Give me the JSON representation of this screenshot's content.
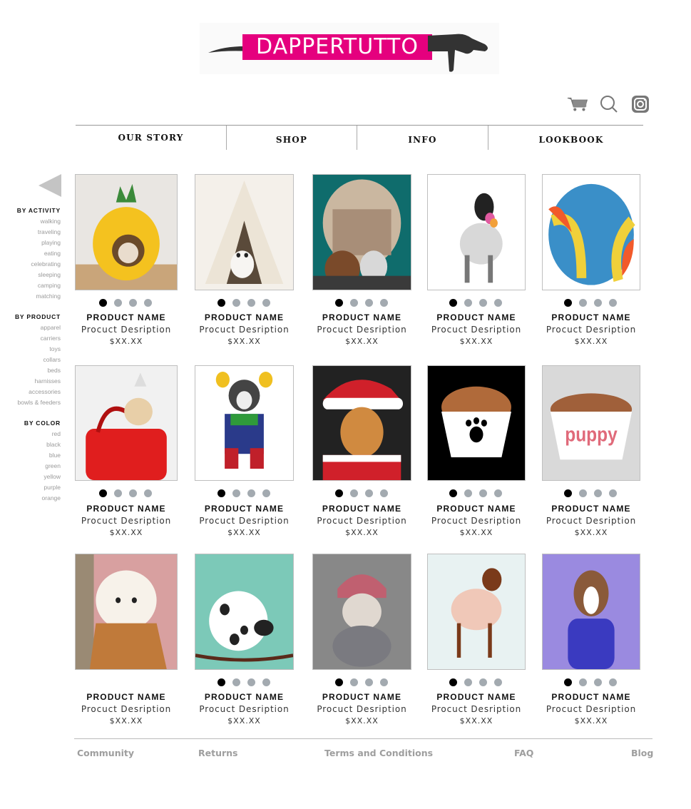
{
  "brand": {
    "logo_text": "DAPPERTUTTO",
    "logo_color": "#e5007e"
  },
  "header_icons": [
    "cart-icon",
    "search-icon",
    "instagram-icon"
  ],
  "nav": [
    {
      "label": "OUR STORY"
    },
    {
      "label": "SHOP"
    },
    {
      "label": "INFO"
    },
    {
      "label": "LOOKBOOK"
    }
  ],
  "sidebar": {
    "activity": {
      "heading": "BY ACTIVITY",
      "items": [
        "walking",
        "traveling",
        "playing",
        "eating",
        "celebrating",
        "sleeping",
        "camping",
        "matching"
      ]
    },
    "product": {
      "heading": "BY PRODUCT",
      "items": [
        "apparel",
        "carriers",
        "toys",
        "collars",
        "beds",
        "harnisses",
        "accessories",
        "bowls & feeders"
      ]
    },
    "color": {
      "heading": "BY COLOR",
      "items": [
        "red",
        "black",
        "blue",
        "green",
        "yellow",
        "purple",
        "orange"
      ]
    }
  },
  "products": [
    {
      "image": "pineapple-dog-bed",
      "name": "PRODUCT NAME",
      "desc": "Procuct Desription",
      "price": "$XX.XX",
      "dots": 4
    },
    {
      "image": "teepee-dog-tent",
      "name": "PRODUCT NAME",
      "desc": "Procuct Desription",
      "price": "$XX.XX",
      "dots": 4
    },
    {
      "image": "dogs-in-camping-tent",
      "name": "PRODUCT NAME",
      "desc": "Procuct Desription",
      "price": "$XX.XX",
      "dots": 4
    },
    {
      "image": "spaniel-with-rope-toy",
      "name": "PRODUCT NAME",
      "desc": "Procuct Desription",
      "price": "$XX.XX",
      "dots": 4
    },
    {
      "image": "tennis-ball-toy",
      "name": "PRODUCT NAME",
      "desc": "Procuct Desription",
      "price": "$XX.XX",
      "dots": 4
    },
    {
      "image": "chihuahua-in-red-bag",
      "name": "PRODUCT NAME",
      "desc": "Procuct Desription",
      "price": "$XX.XX",
      "dots": 4
    },
    {
      "image": "husky-costume",
      "name": "PRODUCT NAME",
      "desc": "Procuct Desription",
      "price": "$XX.XX",
      "dots": 4
    },
    {
      "image": "santa-dog-costume",
      "name": "PRODUCT NAME",
      "desc": "Procuct Desription",
      "price": "$XX.XX",
      "dots": 4
    },
    {
      "image": "paw-print-bowl",
      "name": "PRODUCT NAME",
      "desc": "Procuct Desription",
      "price": "$XX.XX",
      "dots": 4
    },
    {
      "image": "puppy-food-bowl",
      "name": "PRODUCT NAME",
      "desc": "Procuct Desription",
      "price": "$XX.XX",
      "dots": 4
    },
    {
      "image": "pomeranian-in-tote",
      "name": "PRODUCT NAME",
      "desc": "Procuct Desription",
      "price": "$XX.XX",
      "dots": 0
    },
    {
      "image": "dalmatian-leash",
      "name": "PRODUCT NAME",
      "desc": "Procuct Desription",
      "price": "$XX.XX",
      "dots": 4
    },
    {
      "image": "puppy-knit-hat",
      "name": "PRODUCT NAME",
      "desc": "Procuct Desription",
      "price": "$XX.XX",
      "dots": 4
    },
    {
      "image": "dog-pink-sweater",
      "name": "PRODUCT NAME",
      "desc": "Procuct Desription",
      "price": "$XX.XX",
      "dots": 4
    },
    {
      "image": "dog-purple-hoodie",
      "name": "PRODUCT NAME",
      "desc": "Procuct Desription",
      "price": "$XX.XX",
      "dots": 4
    }
  ],
  "footer": [
    {
      "label": "Community"
    },
    {
      "label": "Returns"
    },
    {
      "label": "Terms and Conditions"
    },
    {
      "label": "FAQ"
    },
    {
      "label": "Blog"
    }
  ]
}
